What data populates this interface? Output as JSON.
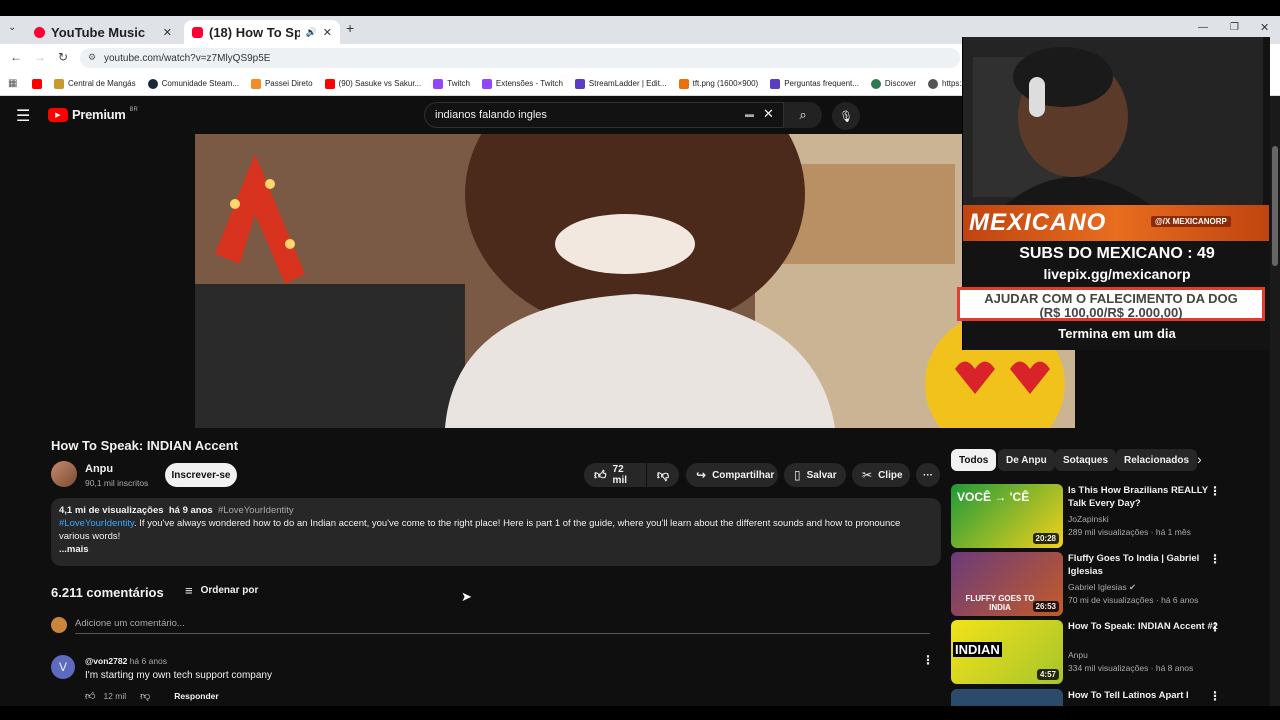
{
  "browser": {
    "tabs": [
      {
        "title": "YouTube Music",
        "close": "✕"
      },
      {
        "title": "(18) How To Speak: INDIAN",
        "close": "✕"
      }
    ],
    "new_tab": "+",
    "url": "youtube.com/watch?v=z7MlyQS9p5E",
    "bookmarks": [
      "Central de Mangás",
      "Comunidade Steam...",
      "Passei Direto",
      "(90) Sasuke vs Sakur...",
      "Twitch",
      "Extensões - Twitch",
      "StreamLadder | Edit...",
      "tft.png (1600×900)",
      "Perguntas frequent...",
      "Discover",
      "https:/"
    ]
  },
  "youtube": {
    "logo": "Premium",
    "region": "BR",
    "search_value": "indianos falando ingles"
  },
  "overlay": {
    "banner": "MEXICANO",
    "handle": "@/X MEXICANORP",
    "subs": "SUBS DO MEXICANO : 49",
    "link": "livepix.gg/mexicanorp",
    "goal_line1": "AJUDAR COM O FALECIMENTO DA DOG",
    "goal_line2": "(R$ 100,00/R$ 2.000,00)",
    "ends": "Termina em um dia"
  },
  "video": {
    "title": "How To Speak: INDIAN Accent",
    "channel": "Anpu",
    "subscribers": "90,1 mil inscritos",
    "subscribe": "Inscrever-se",
    "likes": "72 mil",
    "share": "Compartilhar",
    "save": "Salvar",
    "clip": "Clipe",
    "more": "···",
    "views": "4,1 mi de visualizações",
    "age": "há 9 anos",
    "hashtag": "#LoveYourIdentity",
    "desc_hashtag": "#LoveYourIdentity",
    "desc_text": ". If you've always wondered how to do an Indian accent, you've come to the right place! Here is part 1 of the guide, where you'll learn about the different sounds and how to pronounce various words!",
    "more_desc": "...mais"
  },
  "comments": {
    "count": "6.211 comentários",
    "sort": "Ordenar por",
    "placeholder": "Adicione um comentário...",
    "items": [
      {
        "avatar": "V",
        "author": "@von2782",
        "age": "há 6 anos",
        "text": "I'm starting my own tech support company",
        "likes": "12 mil",
        "reply": "Responder"
      }
    ]
  },
  "sidebar": {
    "chips": [
      "Todos",
      "De Anpu",
      "Sotaques",
      "Relacionados"
    ],
    "videos": [
      {
        "title": "Is This How Brazilians REALLY Talk Every Day?",
        "channel": "JoZapinski",
        "meta": "289 mil visualizações · há 1 mês",
        "duration": "20:28",
        "thumb_text": "VOCÊ → 'CÊ"
      },
      {
        "title": "Fluffy Goes To India | Gabriel Iglesias",
        "channel": "Gabriel Iglesias",
        "meta": "70 mi de visualizações · há 6 anos",
        "duration": "26:53",
        "thumb_text": "FLUFFY GOES TO INDIA"
      },
      {
        "title": "How To Speak: INDIAN Accent #2",
        "channel": "Anpu",
        "meta": "334 mil visualizações · há 8 anos",
        "duration": "4:57",
        "thumb_text": "INDIAN"
      },
      {
        "title": "How To Tell Latinos Apart I",
        "channel": "",
        "meta": "",
        "duration": "",
        "thumb_text": ""
      }
    ]
  },
  "colors": {
    "accent": "#ff0000",
    "link": "#3ea6ff",
    "bg": "#0f0f0f"
  }
}
